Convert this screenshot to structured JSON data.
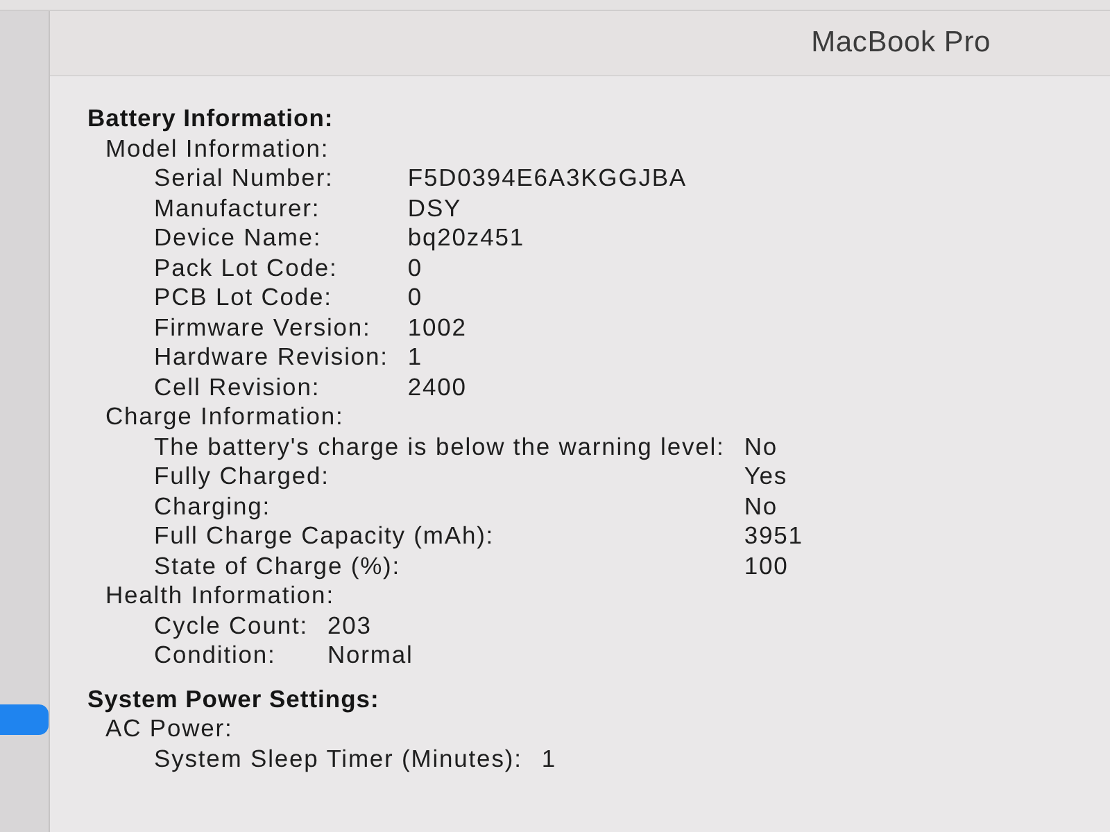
{
  "window": {
    "title": "MacBook Pro"
  },
  "sidebar": {
    "items": [
      {
        "selected": true
      }
    ]
  },
  "sections": [
    {
      "heading": "Battery Information:",
      "groups": [
        {
          "title": "Model Information:",
          "rows": [
            {
              "label": "Serial Number:",
              "value": "F5D0394E6A3KGGJBA"
            },
            {
              "label": "Manufacturer:",
              "value": "DSY"
            },
            {
              "label": "Device Name:",
              "value": "bq20z451"
            },
            {
              "label": "Pack Lot Code:",
              "value": "0"
            },
            {
              "label": "PCB Lot Code:",
              "value": "0"
            },
            {
              "label": "Firmware Version:",
              "value": "1002"
            },
            {
              "label": "Hardware Revision:",
              "value": "1"
            },
            {
              "label": "Cell Revision:",
              "value": "2400"
            }
          ]
        },
        {
          "title": "Charge Information:",
          "rows": [
            {
              "label": "The battery's charge is below the warning level:",
              "value": "No"
            },
            {
              "label": "Fully Charged:",
              "value": "Yes"
            },
            {
              "label": "Charging:",
              "value": "No"
            },
            {
              "label": "Full Charge Capacity (mAh):",
              "value": "3951"
            },
            {
              "label": "State of Charge (%):",
              "value": "100"
            }
          ]
        },
        {
          "title": "Health Information:",
          "rows": [
            {
              "label": "Cycle Count:",
              "value": "203"
            },
            {
              "label": "Condition:",
              "value": "Normal"
            }
          ]
        }
      ]
    },
    {
      "heading": "System Power Settings:",
      "groups": [
        {
          "title": "AC Power:",
          "rows": [
            {
              "label": "System Sleep Timer (Minutes):",
              "value": "1"
            }
          ]
        }
      ]
    }
  ]
}
